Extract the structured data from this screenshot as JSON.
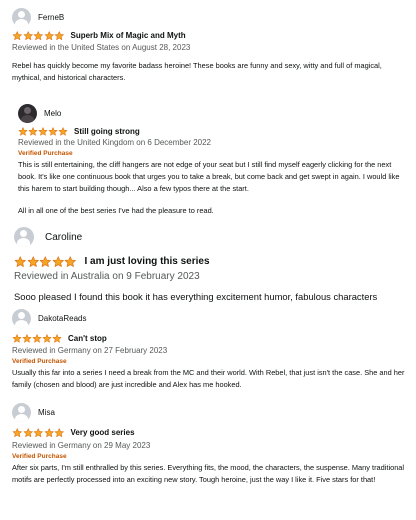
{
  "colors": {
    "star_fill": "#f5a623",
    "star_stroke": "#de7921",
    "verified": "#c45500",
    "meta": "#565959"
  },
  "reviews": [
    {
      "author": "FerneB",
      "rating": 5,
      "title": "Superb Mix of Magic and Myth",
      "date_line": "Reviewed in the United States on August 28, 2023",
      "verified": "",
      "body": [
        "Rebel has quickly become my favorite badass heroine! These books are funny and sexy, witty and full of magical, mythical, and historical characters."
      ]
    },
    {
      "author": "Melo",
      "rating": 5,
      "title": "Still going strong",
      "date_line": "Reviewed in the United Kingdom on 6 December 2022",
      "verified": "Verified Purchase",
      "body": [
        "This is still entertaining, the cliff hangers are not edge of your seat but I still find myself eagerly clicking for the next book. It's like one continuous book that urges you to take a break, but come back and get swept in again. I would like this harem to start building though... Also a few typos there at the start.",
        "All in all one of the best series I've had the pleasure to read."
      ]
    },
    {
      "author": "Caroline",
      "rating": 5,
      "title": "I am just loving this series",
      "date_line": "Reviewed in Australia on 9 February 2023",
      "verified": "",
      "body": [
        "Sooo pleased I found this book it has everything excitement humor, fabulous characters"
      ]
    },
    {
      "author": "DakotaReads",
      "rating": 5,
      "title": "Can't stop",
      "date_line": "Reviewed in Germany on 27 February 2023",
      "verified": "Verified Purchase",
      "body": [
        "Usually this far into a series I need a break from the MC and their world. With Rebel, that just isn't the case. She and her family (chosen and blood) are just incredible and Alex has me hooked."
      ]
    },
    {
      "author": "Misa",
      "rating": 5,
      "title": "Very good series",
      "date_line": "Reviewed in Germany on 29 May 2023",
      "verified": "Verified Purchase",
      "body": [
        "After six parts, I'm still enthralled by this series. Everything fits, the mood, the characters, the suspense. Many traditional motifs are perfectly processed into an exciting new story. Tough heroine, just the way I like it. Five stars for that!"
      ]
    }
  ]
}
